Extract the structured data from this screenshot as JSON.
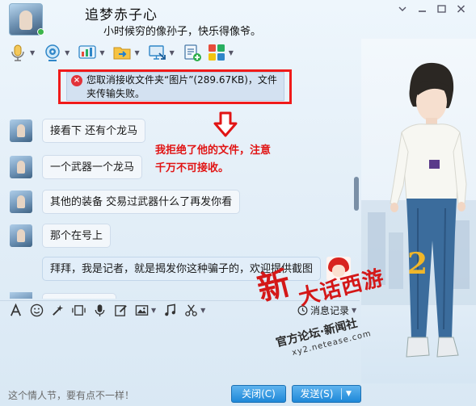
{
  "header": {
    "contact_name": "追梦赤子心",
    "signature": "小时候穷的像孙子，快乐得像爷。"
  },
  "chat": {
    "notice": "您取消接收文件夹“图片”(289.67KB)，文件夹传输失败。",
    "annotation_line1": "我拒绝了他的文件，注意",
    "annotation_line2": "千万不可接收。",
    "messages": [
      {
        "text": "接看下 还有个龙马"
      },
      {
        "text": "一个武器一个龙马"
      },
      {
        "text": "其他的装备   交易过武器什么了再发你看"
      },
      {
        "text": "那个在号上"
      },
      {
        "text": "拜拜，我是记者，就是揭发你这种骗子的，欢迎提供截图"
      }
    ]
  },
  "input": {
    "history_label": "消息记录"
  },
  "footer": {
    "tip": "这个情人节，要有点不一样！",
    "close_label": "关闭(C)",
    "send_label": "发送(S)"
  },
  "watermark": {
    "xin": "新",
    "title": "大话西游",
    "two": "2",
    "sub": "官方论坛·新闻社",
    "url": "xy2.netease.com"
  },
  "colors": {
    "accent": "#1e88d8",
    "annotation": "#e11414",
    "highlight_box": "#f01a1a"
  }
}
